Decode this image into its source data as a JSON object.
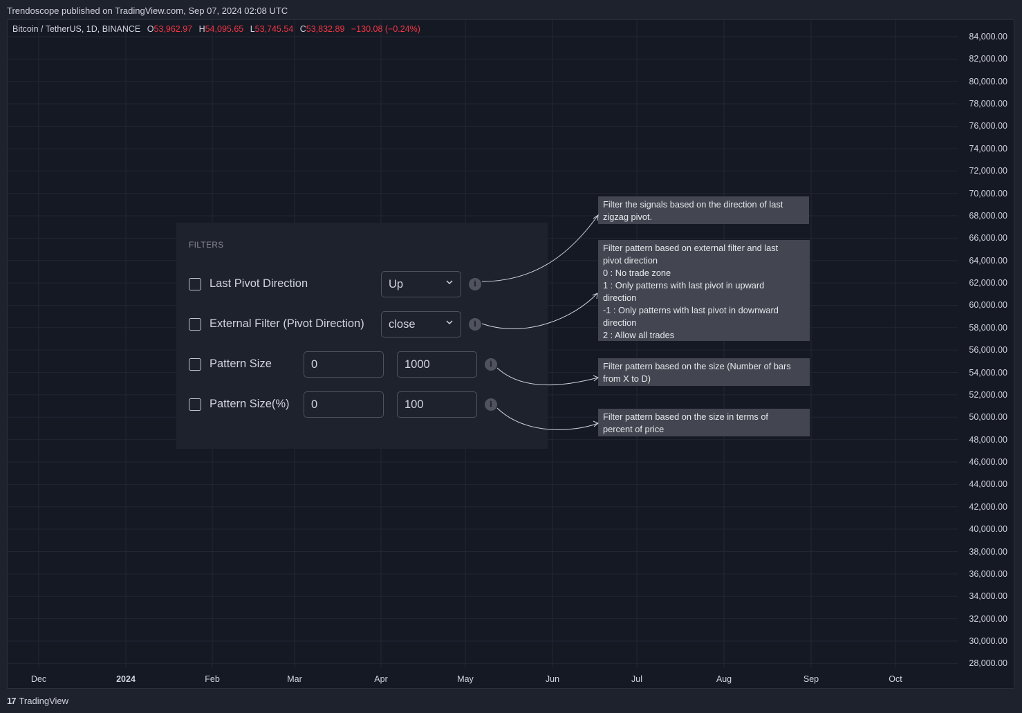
{
  "header": {
    "published": "Trendoscope published on TradingView.com, Sep 07, 2024 02:08 UTC"
  },
  "symbol": {
    "name": "Bitcoin / TetherUS, 1D, BINANCE",
    "o_label": "O",
    "o_value": "53,962.97",
    "h_label": "H",
    "h_value": "54,095.65",
    "l_label": "L",
    "l_value": "53,745.54",
    "c_label": "C",
    "c_value": "53,832.89",
    "change": "−130.08 (−0.24%)"
  },
  "price_axis": [
    "84,000.00",
    "82,000.00",
    "80,000.00",
    "78,000.00",
    "76,000.00",
    "74,000.00",
    "72,000.00",
    "70,000.00",
    "68,000.00",
    "66,000.00",
    "64,000.00",
    "62,000.00",
    "60,000.00",
    "58,000.00",
    "56,000.00",
    "54,000.00",
    "52,000.00",
    "50,000.00",
    "48,000.00",
    "46,000.00",
    "44,000.00",
    "42,000.00",
    "40,000.00",
    "38,000.00",
    "36,000.00",
    "34,000.00",
    "32,000.00",
    "30,000.00",
    "28,000.00"
  ],
  "time_axis": [
    {
      "label": "Dec",
      "bold": false
    },
    {
      "label": "2024",
      "bold": true
    },
    {
      "label": "Feb",
      "bold": false
    },
    {
      "label": "Mar",
      "bold": false
    },
    {
      "label": "Apr",
      "bold": false
    },
    {
      "label": "May",
      "bold": false
    },
    {
      "label": "Jun",
      "bold": false
    },
    {
      "label": "Jul",
      "bold": false
    },
    {
      "label": "Aug",
      "bold": false
    },
    {
      "label": "Sep",
      "bold": false
    },
    {
      "label": "Oct",
      "bold": false
    }
  ],
  "filters": {
    "title": "FILTERS",
    "last_pivot": {
      "label": "Last Pivot Direction",
      "value": "Up"
    },
    "external": {
      "label": "External Filter (Pivot Direction)",
      "value": "close"
    },
    "pattern_size": {
      "label": "Pattern Size",
      "min": "0",
      "max": "1000"
    },
    "pattern_size_pct": {
      "label": "Pattern Size(%)",
      "min": "0",
      "max": "100"
    },
    "info_glyph": "i"
  },
  "tooltips": {
    "last_pivot": "Filter the signals based on the direction of last\nzigzag pivot.",
    "external": "Filter pattern based on external filter and last\npivot direction\n 0 : No trade zone\n 1 : Only patterns with last pivot in upward\ndirection\n-1 : Only patterns with last pivot in downward\ndirection\n 2 : Allow all trades",
    "pattern_size": "Filter pattern based on the size (Number of bars\nfrom X to D)",
    "pattern_size_pct": "Filter pattern based on the size in terms of\npercent of price"
  },
  "footer": {
    "logo": "17",
    "brand": "TradingView"
  },
  "colors": {
    "background": "#151924",
    "down": "#f23645",
    "tooltip": "#434651"
  }
}
